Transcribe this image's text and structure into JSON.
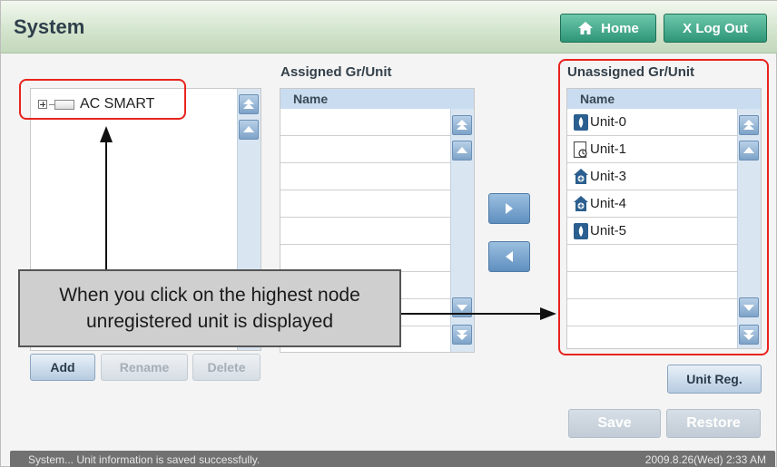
{
  "header": {
    "title": "System",
    "home_label": "Home",
    "logout_label": "X Log Out"
  },
  "tree": {
    "root_label": "AC SMART"
  },
  "assigned": {
    "heading": "Assigned Gr/Unit",
    "column": "Name"
  },
  "unassigned": {
    "heading": "Unassigned Gr/Unit",
    "column": "Name",
    "items": [
      {
        "label": "Unit-0",
        "icon": "indoor-unit-icon"
      },
      {
        "label": "Unit-1",
        "icon": "ventilation-unit-icon"
      },
      {
        "label": "Unit-3",
        "icon": "house-unit-icon"
      },
      {
        "label": "Unit-4",
        "icon": "house-unit-icon"
      },
      {
        "label": "Unit-5",
        "icon": "indoor-unit-icon"
      }
    ]
  },
  "buttons": {
    "add": "Add",
    "rename": "Rename",
    "delete": "Delete",
    "unit_reg": "Unit Reg.",
    "save": "Save",
    "restore": "Restore"
  },
  "callout": {
    "line1": "When you click on the highest node",
    "line2": "unregistered unit is displayed"
  },
  "status": {
    "message": "System... Unit information is saved successfully.",
    "datetime": "2009.8.26(Wed)  2:33 AM"
  },
  "colors": {
    "header_green": "#c3d8bc",
    "button_teal": "#2e9577",
    "highlight_red": "#e8231d",
    "list_header_blue": "#c9dcf0"
  }
}
